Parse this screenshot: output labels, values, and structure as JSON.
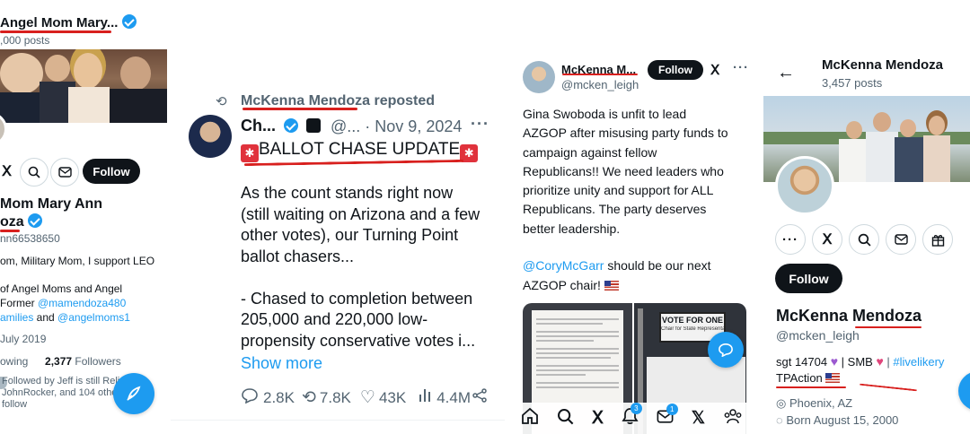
{
  "panel1": {
    "header_name": "Angel Mom Mary...",
    "header_posts": ",000 posts",
    "follow_label": "Follow",
    "name_line1": "Mom Mary Ann",
    "name_line2": "oza",
    "handle": "nn66538650",
    "bio_line1": "om, Military Mom, I support LEO",
    "bio_line2": "of Angel Moms and Angel",
    "bio_line3_prefix": "Former ",
    "bio_line3_link": "@mamendoza480",
    "bio_line4_link1": "amilies",
    "bio_line4_mid": " and ",
    "bio_line4_link2": "@angelmoms1",
    "joined": "July 2019",
    "following_label": "owing",
    "followers_count": "2,377",
    "followers_label": "Followers",
    "followed_by_line1": "Followed by Jeff is still Relia",
    "followed_by_line2": "JohnRocker, and 104 other",
    "followed_by_line3": "follow"
  },
  "panel2": {
    "repost_text": "McKenna Mendoza reposted",
    "author_name": "Ch...",
    "author_handle": "@...",
    "date": "· Nov 9, 2024",
    "headline": "BALLOT CHASE UPDATE",
    "body_lines": [
      "As the count stands right now",
      "(still waiting on Arizona and a few",
      "other votes), our Turning Point",
      "ballot chasers...",
      "",
      "- Chased to completion between",
      "205,000 and 220,000 low-",
      "propensity conservative votes i..."
    ],
    "show_more": "Show more",
    "replies": "2.8K",
    "reposts": "7.8K",
    "likes": "43K",
    "views": "4.4M"
  },
  "panel3": {
    "author_name": "McKenna M...",
    "author_handle": "@mcken_leigh",
    "follow_label": "Follow",
    "body_lines": [
      "Gina Swoboda is unfit to lead",
      "AZGOP after misusing party funds to",
      "campaign against fellow",
      "Republicans!! We need leaders who",
      "prioritize unity and support for ALL",
      "Republicans. The party deserves",
      "better leadership."
    ],
    "mention": "@CoryMcGarr",
    "line2_rest": " should be our next",
    "line3": "AZGOP chair!",
    "sign_line1": "VOTE FOR ONE",
    "sign_line2": "Chair for State Representative",
    "badge_notifications": "3",
    "badge_messages": "1"
  },
  "panel4": {
    "header_name": "McKenna Mendoza",
    "header_posts": "3,457 posts",
    "follow_label": "Follow",
    "display_name": "McKenna Mendoza",
    "handle": "@mcken_leigh",
    "bio_prefix": "sgt 14704",
    "bio_mid": " | SMB ",
    "bio_sep": " | ",
    "bio_link": "#livelikery",
    "bio_line2": "TPAction",
    "location": "Phoenix, AZ",
    "born": "Born August 15, 2000"
  },
  "colors": {
    "accent": "#1d9bf0",
    "underline": "#d8201e",
    "text": "#0f1419",
    "muted": "#536471"
  }
}
